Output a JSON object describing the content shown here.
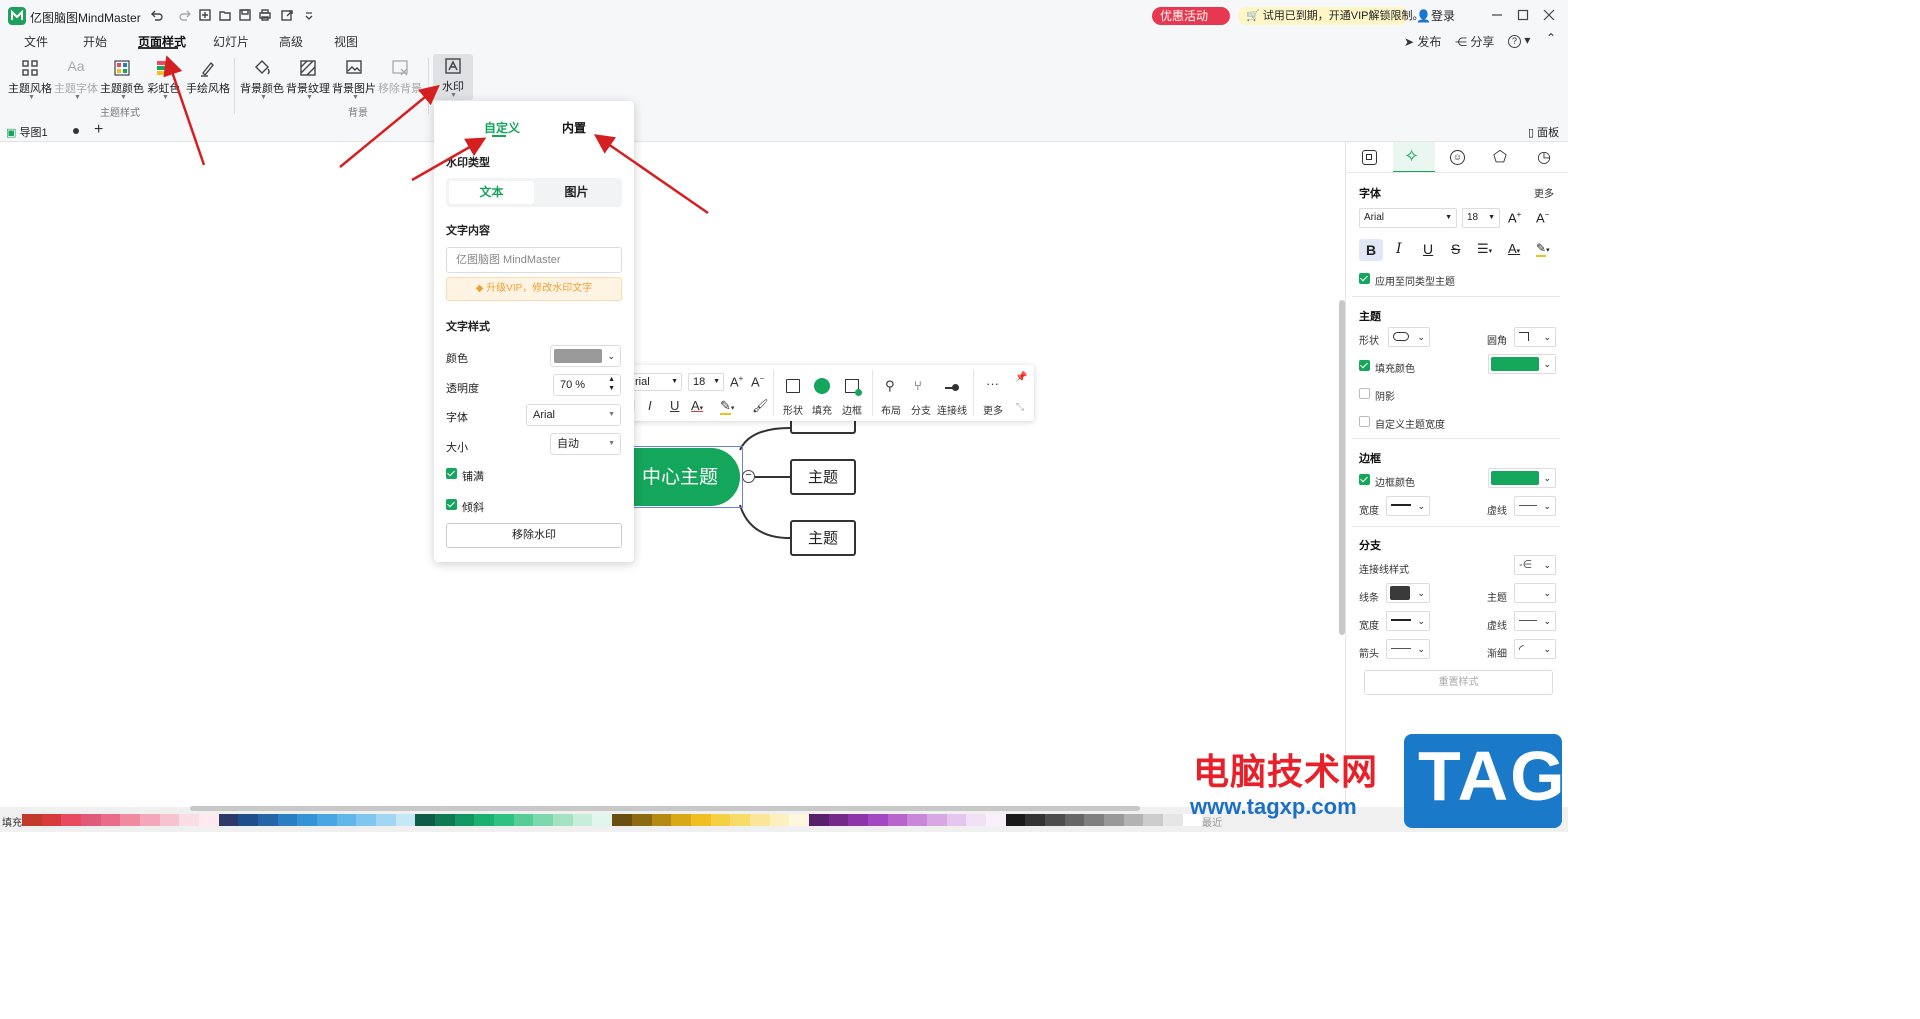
{
  "app": {
    "title": "亿图脑图MindMaster",
    "promo": "优惠活动",
    "vip_banner": "试用已到期，开通VIP解锁限制。",
    "login": "登录"
  },
  "menu": {
    "tabs": [
      "文件",
      "开始",
      "页面样式",
      "幻灯片",
      "高级",
      "视图"
    ],
    "active": "页面样式",
    "publish": "发布",
    "share": "分享",
    "help": "?"
  },
  "ribbon": {
    "theme_style": "主题风格",
    "theme_font": "主题字体",
    "theme_color": "主题颜色",
    "rainbow": "彩虹色",
    "hand_drawn": "手绘风格",
    "group_theme": "主题样式",
    "bg_color": "背景颜色",
    "bg_texture": "背景纹理",
    "bg_image": "背景图片",
    "bg_remove": "移除背景",
    "group_bg": "背景",
    "watermark": "水印"
  },
  "doc_tabs": {
    "tab1": "导图1",
    "add": "+",
    "panel": "面板"
  },
  "watermark_panel": {
    "tab_custom": "自定义",
    "tab_builtin": "内置",
    "type_label": "水印类型",
    "type_text": "文本",
    "type_image": "图片",
    "content_label": "文字内容",
    "content_placeholder": "亿图脑图 MindMaster",
    "vip_hint": "升级VIP，修改水印文字",
    "style_label": "文字样式",
    "color_label": "颜色",
    "color_value": "#9a9a9a",
    "opacity_label": "透明度",
    "opacity_value": "70 %",
    "font_label": "字体",
    "font_value": "Arial",
    "size_label": "大小",
    "size_value": "自动",
    "tile_label": "铺满",
    "tile_checked": true,
    "tilt_label": "倾斜",
    "tilt_checked": true,
    "remove_btn": "移除水印"
  },
  "mindmap": {
    "center": "中心主题",
    "topics": [
      "主题",
      "主题",
      "主题"
    ],
    "collapse": "−"
  },
  "float_toolbar": {
    "font": "rial",
    "size": "18",
    "shape": "形状",
    "fill": "填充",
    "border": "边框",
    "layout": "布局",
    "branch": "分支",
    "connector": "连接线",
    "more": "更多"
  },
  "right_panel": {
    "font_header": "字体",
    "more": "更多",
    "font_value": "Arial",
    "font_size": "18",
    "apply_same": "应用至同类型主题",
    "topic_header": "主题",
    "shape": "形状",
    "corner": "圆角",
    "fill_color": "填充颜色",
    "shadow": "阴影",
    "custom_width": "自定义主题宽度",
    "border_header": "边框",
    "border_color": "边框颜色",
    "width": "宽度",
    "dash": "虚线",
    "branch_header": "分支",
    "connector_style": "连接线样式",
    "line": "线条",
    "topic": "主题",
    "width2": "宽度",
    "dash2": "虚线",
    "arrow": "箭头",
    "taper": "渐细",
    "reset": "重置样式",
    "accent": "#14a65b"
  },
  "palette": {
    "fill_label": "填充",
    "recent_label": "最近",
    "colors": [
      "#c0392b",
      "#d63a3a",
      "#e84a5f",
      "#e05a7a",
      "#ea6c8a",
      "#f08aa0",
      "#f4a7b9",
      "#f7c3cf",
      "#fbdde4",
      "#fde9ee",
      "#2b3a67",
      "#1f4e8c",
      "#2465a8",
      "#2a7fc4",
      "#3593d8",
      "#4aa6e3",
      "#62b7ea",
      "#80c7ef",
      "#a2d7f4",
      "#c6e7f8",
      "#0d5c46",
      "#0e7a55",
      "#129663",
      "#19b070",
      "#2fc17f",
      "#56cd95",
      "#7dd8ad",
      "#a3e3c4",
      "#c6eed9",
      "#e2f7ec",
      "#6b4f10",
      "#8c6a12",
      "#b58a14",
      "#d9a818",
      "#f0c020",
      "#f5d040",
      "#f8dc6a",
      "#fae696",
      "#fcf0bf",
      "#fef7e0",
      "#5a1f6b",
      "#73288a",
      "#8d34a8",
      "#a547c0",
      "#b765cd",
      "#c887d9",
      "#d8a8e4",
      "#e6c6ee",
      "#f1e0f6",
      "#faf0fb",
      "#1a1a1a",
      "#333333",
      "#4d4d4d",
      "#666666",
      "#808080",
      "#999999",
      "#b3b3b3",
      "#cccccc",
      "#e6e6e6",
      "#ffffff"
    ]
  },
  "branding": {
    "site_name": "电脑技术网",
    "site_url": "www.tagxp.com",
    "logo_text": "TAG"
  }
}
